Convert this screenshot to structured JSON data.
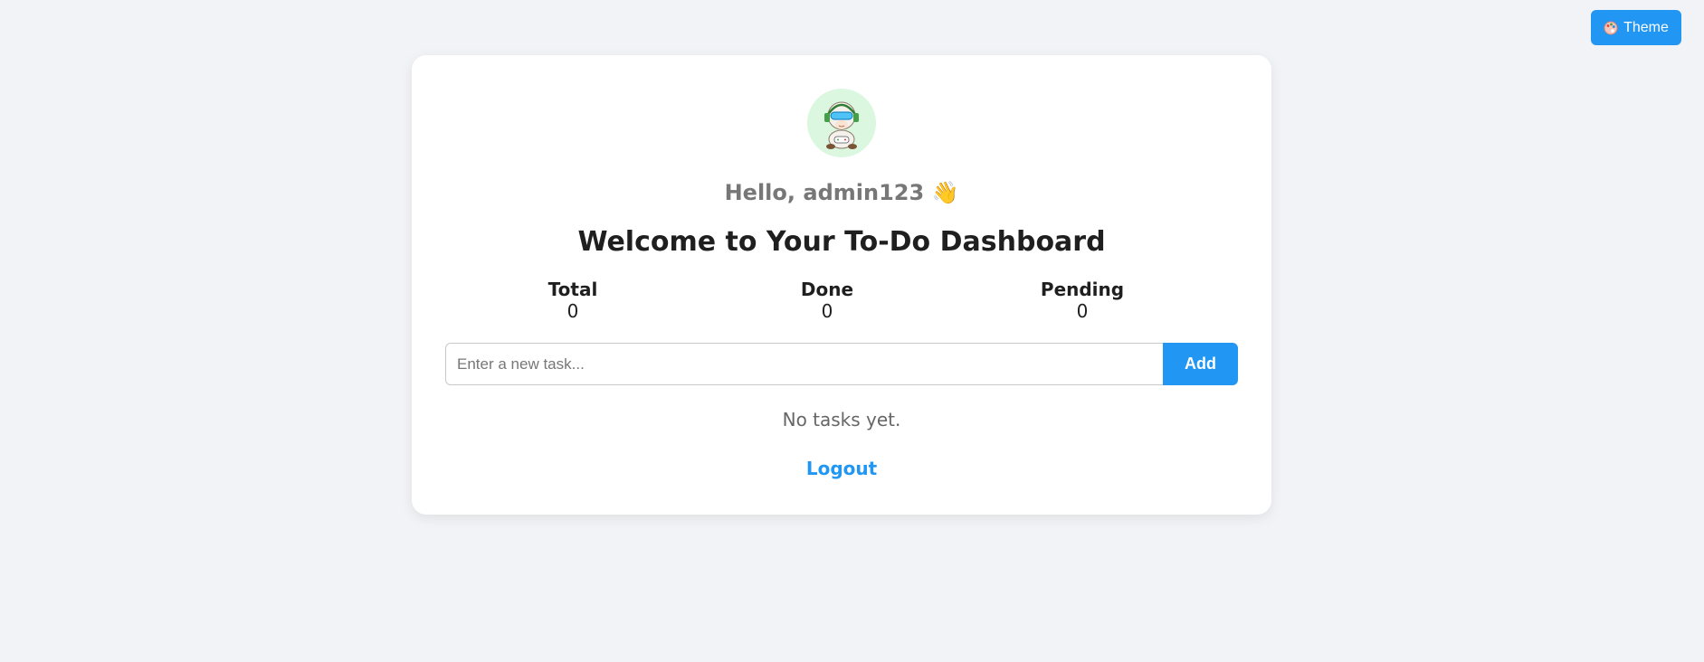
{
  "header": {
    "theme_label": "Theme",
    "theme_icon": "palette-icon"
  },
  "profile": {
    "avatar_icon": "sheep-avatar",
    "greeting": "Hello, admin123 👋"
  },
  "dashboard": {
    "title": "Welcome to Your To-Do Dashboard",
    "stats": [
      {
        "label": "Total",
        "value": "0"
      },
      {
        "label": "Done",
        "value": "0"
      },
      {
        "label": "Pending",
        "value": "0"
      }
    ]
  },
  "task_form": {
    "placeholder": "Enter a new task...",
    "value": "",
    "add_label": "Add"
  },
  "task_list": {
    "empty_message": "No tasks yet."
  },
  "footer": {
    "logout_label": "Logout"
  },
  "colors": {
    "accent": "#2196f3",
    "background": "#f2f3f6",
    "card": "#ffffff",
    "avatar_bg": "#dcf7df"
  }
}
